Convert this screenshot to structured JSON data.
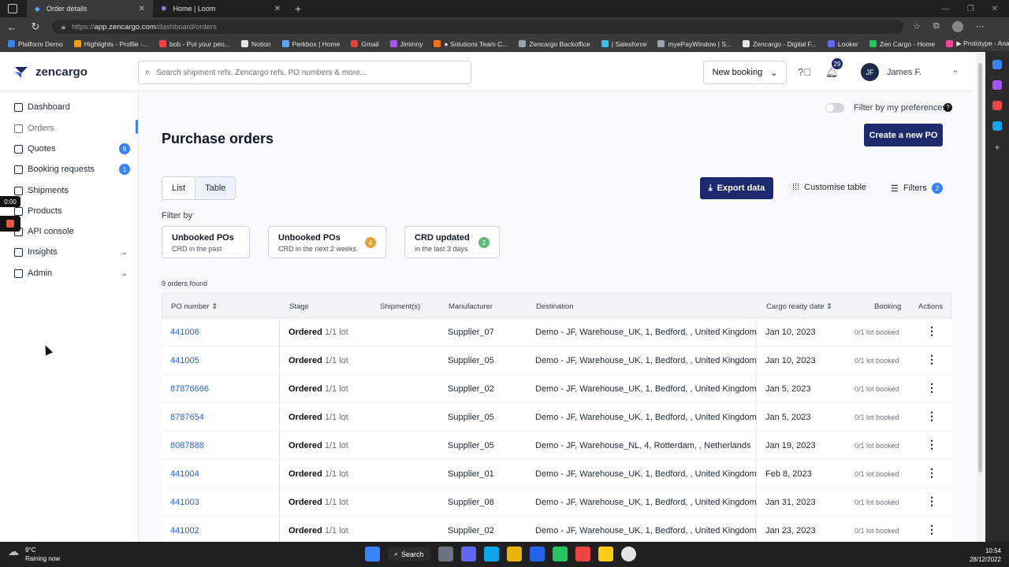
{
  "browser": {
    "tabs": [
      {
        "title": "Order details",
        "active": true
      },
      {
        "title": "Home | Loom",
        "active": false
      }
    ],
    "url_scheme": "https://",
    "url_host": "app.zencargo.com",
    "url_path": "/dashboard/orders",
    "bookmarks": [
      {
        "label": "Platform Demo",
        "color": "#3b82f6"
      },
      {
        "label": "Highlights - Profile -...",
        "color": "#f59e0b"
      },
      {
        "label": "bob - Put your peo...",
        "color": "#ef4444"
      },
      {
        "label": "Notion",
        "color": "#e5e5e5"
      },
      {
        "label": "Perkbox | Home",
        "color": "#60a5fa"
      },
      {
        "label": "Gmail",
        "color": "#ea4335"
      },
      {
        "label": "Jiminny",
        "color": "#a855f7"
      },
      {
        "label": "● Solutions Team C...",
        "color": "#f97316"
      },
      {
        "label": "Zencargo Backoffice",
        "color": "#9ca3af"
      },
      {
        "label": "| Salesforce",
        "color": "#38bdf8"
      },
      {
        "label": "myePayWindow | S...",
        "color": "#9ca3af"
      },
      {
        "label": "Zencargo - Digital F...",
        "color": "#e5e5e5"
      },
      {
        "label": "Looker",
        "color": "#6366f1"
      },
      {
        "label": "Zen Cargo - Home",
        "color": "#22c55e"
      },
      {
        "label": "▶ Prototype - Anan...",
        "color": "#ec4899"
      }
    ]
  },
  "header": {
    "brand": "zencargo",
    "search_placeholder": "Search shipment refs, Zencargo refs, PO numbers & more...",
    "new_booking": "New booking",
    "notifications_count": "29",
    "user_initials": "JF",
    "user_name": "James F."
  },
  "sidebar": {
    "items": [
      {
        "label": "Dashboard"
      },
      {
        "label": "Orders",
        "active": true
      },
      {
        "label": "Quotes",
        "badge": "9"
      },
      {
        "label": "Booking requests",
        "badge": "1"
      },
      {
        "label": "Shipments"
      },
      {
        "label": "Products"
      },
      {
        "label": "API console"
      },
      {
        "label": "Insights",
        "expandable": true
      },
      {
        "label": "Admin",
        "expandable": true
      }
    ]
  },
  "recorder": {
    "timer": "0:00"
  },
  "main": {
    "title": "Purchase orders",
    "pref_toggle_label": "Filter by my preferences",
    "create_po": "Create a new PO",
    "view_list": "List",
    "view_table": "Table",
    "export": "Export data",
    "customise": "Customise table",
    "filters": "Filters",
    "filters_count": "2",
    "filter_by": "Filter by",
    "chips": [
      {
        "title": "Unbooked POs",
        "subtitle": "CRD in the past",
        "badge": "",
        "badge_color": ""
      },
      {
        "title": "Unbooked POs",
        "subtitle": "CRD in the next 2 weeks",
        "badge": "4",
        "badge_color": "#e8a23b"
      },
      {
        "title": "CRD updated",
        "subtitle": "in the last 3 days",
        "badge": "2",
        "badge_color": "#5fb97a"
      }
    ],
    "orders_found": "9 orders found",
    "columns": {
      "po": "PO number",
      "stage": "Stage",
      "shipments": "Shipment(s)",
      "manufacturer": "Manufacturer",
      "destination": "Destination",
      "crd": "Cargo ready date",
      "booking": "Booking",
      "actions": "Actions"
    },
    "rows": [
      {
        "po": "441006",
        "stage": "Ordered",
        "lot": "1/1 lot",
        "manufacturer": "Supplier_07",
        "destination": "Demo - JF, Warehouse_UK, 1, Bedford, , United Kingdom",
        "crd": "Jan 10, 2023",
        "booking": "0/1 lot booked"
      },
      {
        "po": "441005",
        "stage": "Ordered",
        "lot": "1/1 lot",
        "manufacturer": "Supplier_05",
        "destination": "Demo - JF, Warehouse_UK, 1, Bedford, , United Kingdom",
        "crd": "Jan 10, 2023",
        "booking": "0/1 lot booked"
      },
      {
        "po": "87876666",
        "stage": "Ordered",
        "lot": "1/1 lot",
        "manufacturer": "Supplier_02",
        "destination": "Demo - JF, Warehouse_UK, 1, Bedford, , United Kingdom",
        "crd": "Jan 5, 2023",
        "booking": "0/1 lot booked"
      },
      {
        "po": "8787654",
        "stage": "Ordered",
        "lot": "1/1 lot",
        "manufacturer": "Supplier_05",
        "destination": "Demo - JF, Warehouse_UK, 1, Bedford, , United Kingdom",
        "crd": "Jan 5, 2023",
        "booking": "0/1 lot booked"
      },
      {
        "po": "8087888",
        "stage": "Ordered",
        "lot": "1/1 lot",
        "manufacturer": "Supplier_05",
        "destination": "Demo - JF, Warehouse_NL, 4, Rotterdam, , Netherlands",
        "crd": "Jan 19, 2023",
        "booking": "0/1 lot booked"
      },
      {
        "po": "441004",
        "stage": "Ordered",
        "lot": "1/1 lot",
        "manufacturer": "Supplier_01",
        "destination": "Demo - JF, Warehouse_UK, 1, Bedford, , United Kingdom",
        "crd": "Feb 8, 2023",
        "booking": "0/1 lot booked"
      },
      {
        "po": "441003",
        "stage": "Ordered",
        "lot": "1/1 lot",
        "manufacturer": "Supplier_08",
        "destination": "Demo - JF, Warehouse_UK, 1, Bedford, , United Kingdom",
        "crd": "Jan 31, 2023",
        "booking": "0/1 lot booked"
      },
      {
        "po": "441002",
        "stage": "Ordered",
        "lot": "1/1 lot",
        "manufacturer": "Supplier_02",
        "destination": "Demo - JF, Warehouse_UK, 1, Bedford, , United Kingdom",
        "crd": "Jan 23, 2023",
        "booking": "0/1 lot booked"
      }
    ]
  },
  "taskbar": {
    "temp": "9°C",
    "weather": "Raining now",
    "search": "Search",
    "time": "10:54",
    "date": "28/12/2022"
  },
  "colors": {
    "brand_navy": "#1e2a6e",
    "link_blue": "#2563eb",
    "badge_blue": "#3b82f6"
  }
}
